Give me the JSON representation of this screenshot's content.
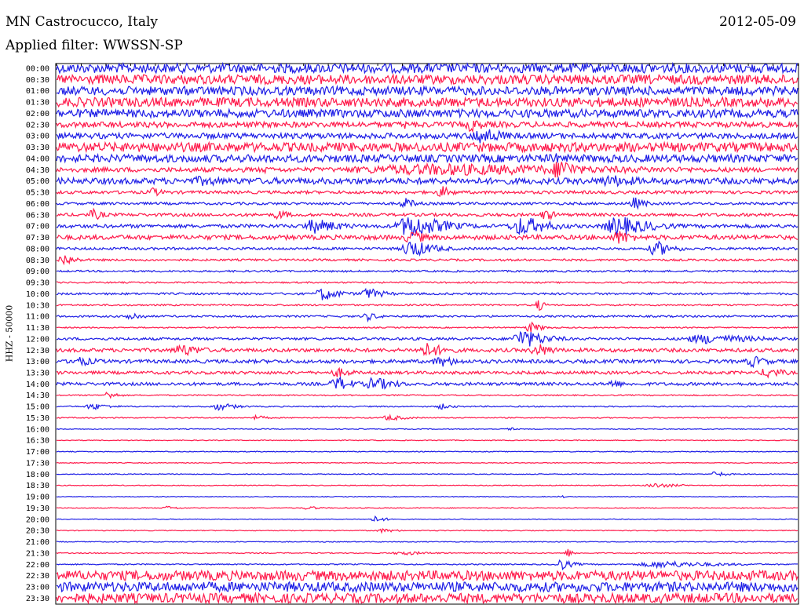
{
  "header": {
    "station": "MN Castrocucco, Italy",
    "date": "2012-05-09",
    "filter": "Applied filter: WWSSN-SP"
  },
  "chart_data": {
    "type": "line",
    "ylabel": "HHZ - 50000",
    "colors": [
      "#1e1ee6",
      "#ff1a4b"
    ],
    "rows": [
      {
        "label": "00:00",
        "noise": 0.92,
        "events": []
      },
      {
        "label": "00:30",
        "noise": 0.92,
        "events": []
      },
      {
        "label": "01:00",
        "noise": 0.85,
        "events": []
      },
      {
        "label": "01:30",
        "noise": 0.9,
        "events": []
      },
      {
        "label": "02:00",
        "noise": 0.8,
        "events": []
      },
      {
        "label": "02:30",
        "noise": 0.55,
        "events": [
          {
            "t": 0.56,
            "amp": 1.4,
            "dur": 0.03
          },
          {
            "t": 0.47,
            "amp": 1.0,
            "dur": 0.004
          }
        ]
      },
      {
        "label": "03:00",
        "noise": 0.55,
        "events": [
          {
            "t": 0.575,
            "amp": 1.9,
            "dur": 0.04
          }
        ]
      },
      {
        "label": "03:30",
        "noise": 0.9,
        "events": []
      },
      {
        "label": "04:00",
        "noise": 0.75,
        "events": [
          {
            "t": 0.67,
            "amp": 1.2,
            "dur": 0.03
          }
        ]
      },
      {
        "label": "04:30",
        "noise": 0.45,
        "events": [
          {
            "t": 0.53,
            "amp": 1.2,
            "dur": 0.45
          },
          {
            "t": 0.68,
            "amp": 2.5,
            "dur": 0.03
          },
          {
            "t": 0.28,
            "amp": 0.8,
            "dur": 0.02
          }
        ]
      },
      {
        "label": "05:00",
        "noise": 0.6,
        "events": [
          {
            "t": 0.2,
            "amp": 1.0,
            "dur": 0.08
          },
          {
            "t": 0.75,
            "amp": 1.2,
            "dur": 0.08
          }
        ]
      },
      {
        "label": "05:30",
        "noise": 0.3,
        "events": [
          {
            "t": 0.13,
            "amp": 1.0,
            "dur": 0.02
          },
          {
            "t": 0.52,
            "amp": 1.3,
            "dur": 0.02
          }
        ]
      },
      {
        "label": "06:00",
        "noise": 0.25,
        "events": [
          {
            "t": 0.47,
            "amp": 1.2,
            "dur": 0.02
          },
          {
            "t": 0.78,
            "amp": 1.3,
            "dur": 0.02
          }
        ]
      },
      {
        "label": "06:30",
        "noise": 0.3,
        "events": [
          {
            "t": 0.05,
            "amp": 1.2,
            "dur": 0.02
          },
          {
            "t": 0.3,
            "amp": 1.1,
            "dur": 0.02
          },
          {
            "t": 0.66,
            "amp": 1.2,
            "dur": 0.02
          }
        ]
      },
      {
        "label": "07:00",
        "noise": 0.35,
        "events": [
          {
            "t": 0.35,
            "amp": 1.5,
            "dur": 0.05
          },
          {
            "t": 0.48,
            "amp": 2.4,
            "dur": 0.06
          },
          {
            "t": 0.63,
            "amp": 2.0,
            "dur": 0.05
          },
          {
            "t": 0.76,
            "amp": 2.0,
            "dur": 0.06
          }
        ]
      },
      {
        "label": "07:30",
        "noise": 0.45,
        "events": [
          {
            "t": 0.48,
            "amp": 1.5,
            "dur": 0.03
          },
          {
            "t": 0.76,
            "amp": 1.5,
            "dur": 0.03
          }
        ]
      },
      {
        "label": "08:00",
        "noise": 0.25,
        "events": [
          {
            "t": 0.48,
            "amp": 1.8,
            "dur": 0.04
          },
          {
            "t": 0.81,
            "amp": 1.6,
            "dur": 0.03
          }
        ]
      },
      {
        "label": "08:30",
        "noise": 0.2,
        "events": [
          {
            "t": 0.01,
            "amp": 1.3,
            "dur": 0.02
          }
        ]
      },
      {
        "label": "09:00",
        "noise": 0.18,
        "events": []
      },
      {
        "label": "09:30",
        "noise": 0.15,
        "events": []
      },
      {
        "label": "10:00",
        "noise": 0.2,
        "events": [
          {
            "t": 0.36,
            "amp": 1.4,
            "dur": 0.03
          },
          {
            "t": 0.42,
            "amp": 1.2,
            "dur": 0.03
          }
        ]
      },
      {
        "label": "10:30",
        "noise": 0.15,
        "events": [
          {
            "t": 0.65,
            "amp": 1.3,
            "dur": 0.01
          }
        ]
      },
      {
        "label": "11:00",
        "noise": 0.18,
        "events": [
          {
            "t": 0.1,
            "amp": 1.0,
            "dur": 0.02
          },
          {
            "t": 0.42,
            "amp": 0.9,
            "dur": 0.02
          }
        ]
      },
      {
        "label": "11:30",
        "noise": 0.12,
        "events": [
          {
            "t": 0.64,
            "amp": 1.1,
            "dur": 0.02
          }
        ]
      },
      {
        "label": "12:00",
        "noise": 0.25,
        "events": [
          {
            "t": 0.63,
            "amp": 2.0,
            "dur": 0.04
          },
          {
            "t": 0.88,
            "amp": 1.0,
            "dur": 0.1
          }
        ]
      },
      {
        "label": "12:30",
        "noise": 0.35,
        "events": [
          {
            "t": 0.17,
            "amp": 1.3,
            "dur": 0.04
          },
          {
            "t": 0.5,
            "amp": 1.5,
            "dur": 0.04
          },
          {
            "t": 0.65,
            "amp": 1.4,
            "dur": 0.03
          }
        ]
      },
      {
        "label": "13:00",
        "noise": 0.35,
        "events": [
          {
            "t": 0.03,
            "amp": 1.0,
            "dur": 0.04
          },
          {
            "t": 0.52,
            "amp": 1.1,
            "dur": 0.04
          },
          {
            "t": 0.94,
            "amp": 1.2,
            "dur": 0.03
          }
        ]
      },
      {
        "label": "13:30",
        "noise": 0.3,
        "events": [
          {
            "t": 0.38,
            "amp": 1.0,
            "dur": 0.03
          },
          {
            "t": 0.96,
            "amp": 1.2,
            "dur": 0.03
          }
        ]
      },
      {
        "label": "14:00",
        "noise": 0.3,
        "events": [
          {
            "t": 0.38,
            "amp": 1.5,
            "dur": 0.03
          },
          {
            "t": 0.43,
            "amp": 1.4,
            "dur": 0.04
          },
          {
            "t": 0.75,
            "amp": 1.0,
            "dur": 0.02
          }
        ]
      },
      {
        "label": "14:30",
        "noise": 0.12,
        "events": [
          {
            "t": 0.07,
            "amp": 0.9,
            "dur": 0.015
          }
        ]
      },
      {
        "label": "15:00",
        "noise": 0.12,
        "events": [
          {
            "t": 0.05,
            "amp": 0.7,
            "dur": 0.03
          },
          {
            "t": 0.22,
            "amp": 0.8,
            "dur": 0.03
          },
          {
            "t": 0.52,
            "amp": 0.6,
            "dur": 0.02
          }
        ]
      },
      {
        "label": "15:30",
        "noise": 0.1,
        "events": [
          {
            "t": 0.27,
            "amp": 0.5,
            "dur": 0.02
          },
          {
            "t": 0.45,
            "amp": 0.6,
            "dur": 0.03
          }
        ]
      },
      {
        "label": "16:00",
        "noise": 0.08,
        "events": [
          {
            "t": 0.61,
            "amp": 0.5,
            "dur": 0.01
          }
        ]
      },
      {
        "label": "16:30",
        "noise": 0.08,
        "events": []
      },
      {
        "label": "17:00",
        "noise": 0.08,
        "events": []
      },
      {
        "label": "17:30",
        "noise": 0.08,
        "events": []
      },
      {
        "label": "18:00",
        "noise": 0.08,
        "events": [
          {
            "t": 0.89,
            "amp": 0.6,
            "dur": 0.02
          }
        ]
      },
      {
        "label": "18:30",
        "noise": 0.08,
        "events": [
          {
            "t": 0.81,
            "amp": 0.5,
            "dur": 0.04
          }
        ]
      },
      {
        "label": "19:00",
        "noise": 0.07,
        "events": [
          {
            "t": 0.68,
            "amp": 0.3,
            "dur": 0.01
          }
        ]
      },
      {
        "label": "19:30",
        "noise": 0.08,
        "events": [
          {
            "t": 0.15,
            "amp": 0.4,
            "dur": 0.02
          },
          {
            "t": 0.34,
            "amp": 0.4,
            "dur": 0.02
          }
        ]
      },
      {
        "label": "20:00",
        "noise": 0.07,
        "events": [
          {
            "t": 0.43,
            "amp": 0.6,
            "dur": 0.02
          }
        ]
      },
      {
        "label": "20:30",
        "noise": 0.08,
        "events": [
          {
            "t": 0.44,
            "amp": 0.4,
            "dur": 0.03
          }
        ]
      },
      {
        "label": "21:00",
        "noise": 0.08,
        "events": []
      },
      {
        "label": "21:30",
        "noise": 0.1,
        "events": [
          {
            "t": 0.47,
            "amp": 0.4,
            "dur": 0.05
          },
          {
            "t": 0.69,
            "amp": 0.9,
            "dur": 0.01
          }
        ]
      },
      {
        "label": "22:00",
        "noise": 0.12,
        "events": [
          {
            "t": 0.68,
            "amp": 1.2,
            "dur": 0.02
          },
          {
            "t": 0.82,
            "amp": 0.7,
            "dur": 0.1
          }
        ]
      },
      {
        "label": "22:30",
        "noise": 0.95,
        "events": []
      },
      {
        "label": "23:00",
        "noise": 0.95,
        "events": []
      },
      {
        "label": "23:30",
        "noise": 0.95,
        "events": []
      }
    ]
  }
}
